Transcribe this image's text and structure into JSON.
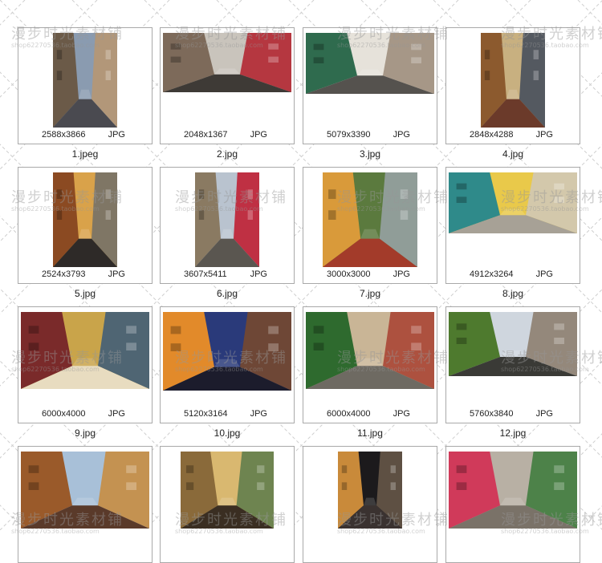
{
  "watermark": {
    "text": "漫步时光素材铺",
    "shop": "shop62270536.taobao.com"
  },
  "items": [
    {
      "name": "1.jpeg",
      "dims": "2588x3866",
      "format": "JPG",
      "palette": [
        "#8a9bb0",
        "#6b5a48",
        "#b89670",
        "#4a4a50"
      ]
    },
    {
      "name": "2.jpg",
      "dims": "2048x1367",
      "format": "JPG",
      "palette": [
        "#c9c4bc",
        "#7d6a5a",
        "#b21f2a",
        "#3e3a36"
      ]
    },
    {
      "name": "3.jpg",
      "dims": "5079x3390",
      "format": "JPG",
      "palette": [
        "#e6e2da",
        "#2f6b4e",
        "#9a8a78",
        "#55524e"
      ]
    },
    {
      "name": "4.jpg",
      "dims": "2848x4288",
      "format": "JPG",
      "palette": [
        "#c8b080",
        "#8c5a2e",
        "#3f4a5a",
        "#6b3a2a"
      ]
    },
    {
      "name": "5.jpg",
      "dims": "2524x3793",
      "format": "JPG",
      "palette": [
        "#d9a24a",
        "#8b4a22",
        "#6e6e6a",
        "#2e2a28"
      ]
    },
    {
      "name": "6.jpg",
      "dims": "3607x5411",
      "format": "JPG",
      "palette": [
        "#b9c3cf",
        "#8a7a62",
        "#c0162a",
        "#5a5650"
      ]
    },
    {
      "name": "7.jpg",
      "dims": "3000x3000",
      "format": "JPG",
      "palette": [
        "#5b7a3e",
        "#d99a3a",
        "#9aa3a8",
        "#a33b2a"
      ]
    },
    {
      "name": "8.jpg",
      "dims": "4912x3264",
      "format": "JPG",
      "palette": [
        "#e9c94a",
        "#2f8a8a",
        "#cfc8bc",
        "#a7a196"
      ]
    },
    {
      "name": "9.jpg",
      "dims": "6000x4000",
      "format": "JPG",
      "palette": [
        "#c9a44a",
        "#7a2a2a",
        "#3a5a7a",
        "#e8dcc0"
      ]
    },
    {
      "name": "10.jpg",
      "dims": "5120x3164",
      "format": "JPG",
      "palette": [
        "#2a3a7a",
        "#e28a2a",
        "#7a4a2a",
        "#1c1c2c"
      ]
    },
    {
      "name": "11.jpg",
      "dims": "6000x4000",
      "format": "JPG",
      "palette": [
        "#c9b596",
        "#2e6a2e",
        "#a84030",
        "#6e6a62"
      ]
    },
    {
      "name": "12.jpg",
      "dims": "5760x3840",
      "format": "JPG",
      "palette": [
        "#cfd6de",
        "#4e7a2e",
        "#8a7a6a",
        "#3a3a36"
      ]
    },
    {
      "name": "",
      "dims": "",
      "format": "",
      "palette": [
        "#a8c0d8",
        "#9a5a2a",
        "#c98a3a",
        "#5a3a2a"
      ]
    },
    {
      "name": "",
      "dims": "",
      "format": "",
      "palette": [
        "#d9b870",
        "#8a6a3a",
        "#5a7a4a",
        "#3a2e22"
      ]
    },
    {
      "name": "",
      "dims": "",
      "format": "",
      "palette": [
        "#1c1a1c",
        "#c98a3a",
        "#6a5a4a",
        "#3a3230"
      ]
    },
    {
      "name": "",
      "dims": "",
      "format": "",
      "palette": [
        "#b8b0a4",
        "#d03a5a",
        "#3a7a3a",
        "#7a7268"
      ]
    }
  ]
}
